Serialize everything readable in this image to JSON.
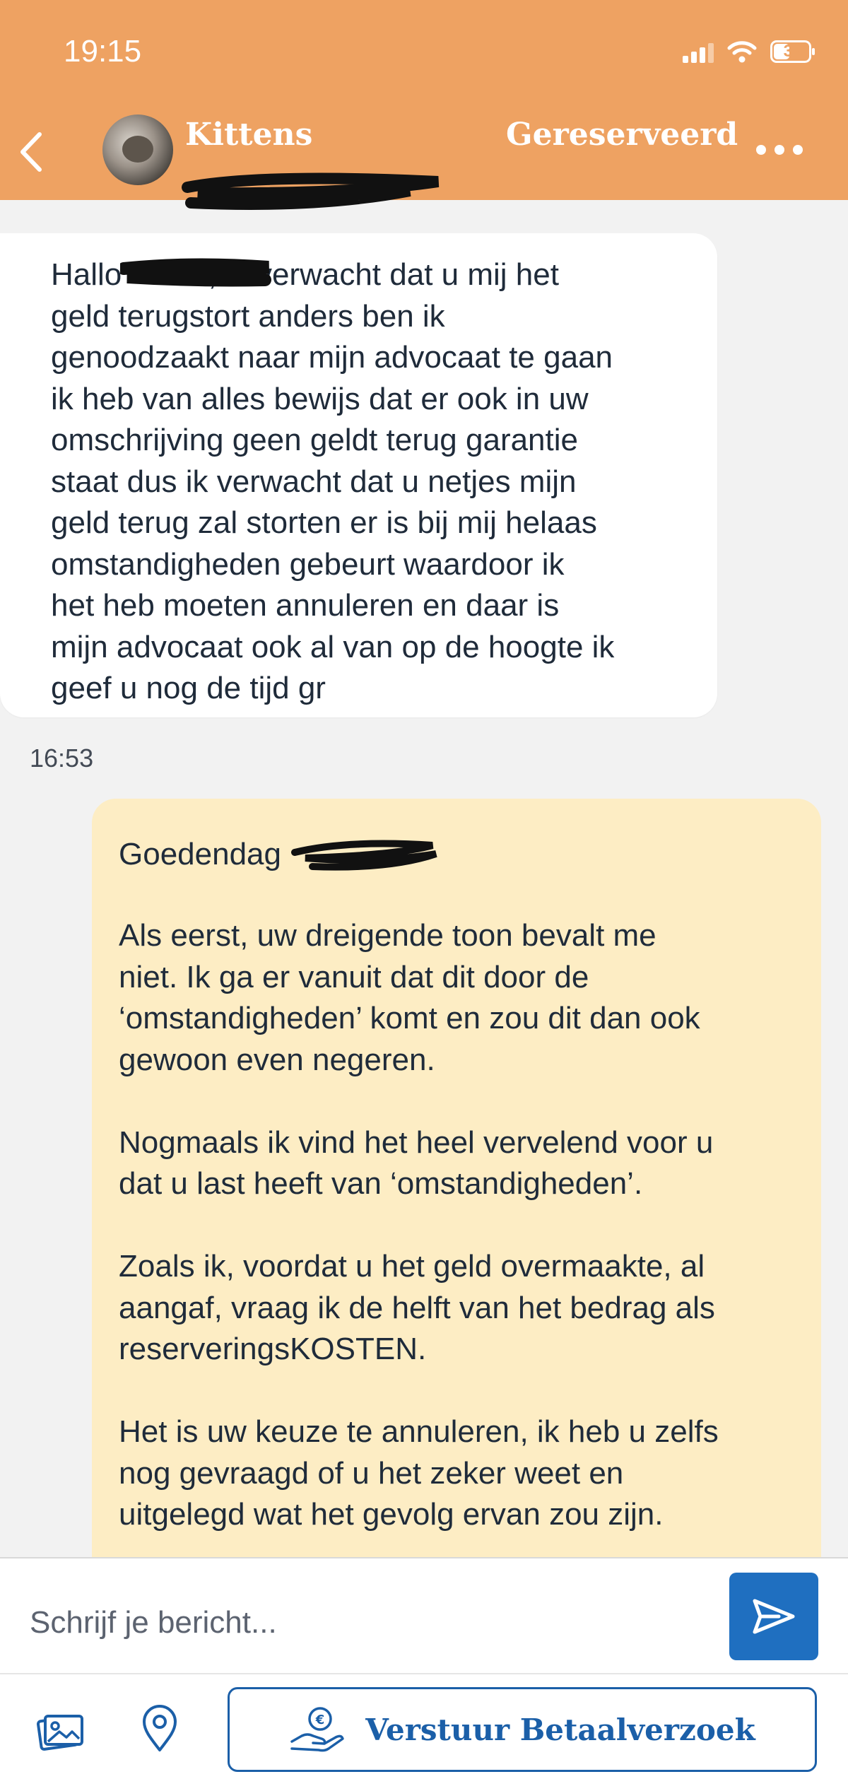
{
  "status_bar": {
    "time": "19:15",
    "battery": "37"
  },
  "header": {
    "contact_name": "Kittens",
    "status": "Gereserveerd"
  },
  "messages": {
    "incoming": {
      "text": "Hallo          , ik verwacht dat u mij het\ngeld terugstort anders ben ik\ngenoodzaakt naar mijn advocaat te gaan\nik heb van alles bewijs dat er ook in uw\nomschrijving geen geldt terug garantie\nstaat dus ik verwacht dat u netjes mijn\ngeld terug zal storten er is bij mij helaas\nomstandigheden gebeurt waardoor ik\nhet heb moeten annuleren en daar is\nmijn advocaat ook al van op de hoogte ik\ngeef u nog de tijd gr",
      "time": "16:53"
    },
    "outgoing": {
      "greeting": "Goedendag",
      "body": "Als eerst, uw dreigende toon bevalt me\nniet. Ik ga er vanuit dat dit door de\n‘omstandigheden’ komt en zou dit dan ook\ngewoon even negeren.\n\nNogmaals ik vind het heel vervelend voor u\ndat u last heeft van ‘omstandigheden’.\n\nZoals ik, voordat u het geld overmaakte, al\naangaf, vraag ik de helft van het bedrag als\nreserveringsKOSTEN.\n\nHet is uw keuze te annuleren, ik heb u zelfs\nnog gevraagd of u het zeker weet en\nuitgelegd wat het gevolg ervan zou zijn."
    }
  },
  "composer": {
    "placeholder": "Schrijf je bericht...",
    "payment_request_label": "Verstuur Betaalverzoek"
  },
  "colors": {
    "header": "#eea262",
    "outgoing_bubble": "#fdedc4",
    "accent": "#1f6fc0"
  }
}
